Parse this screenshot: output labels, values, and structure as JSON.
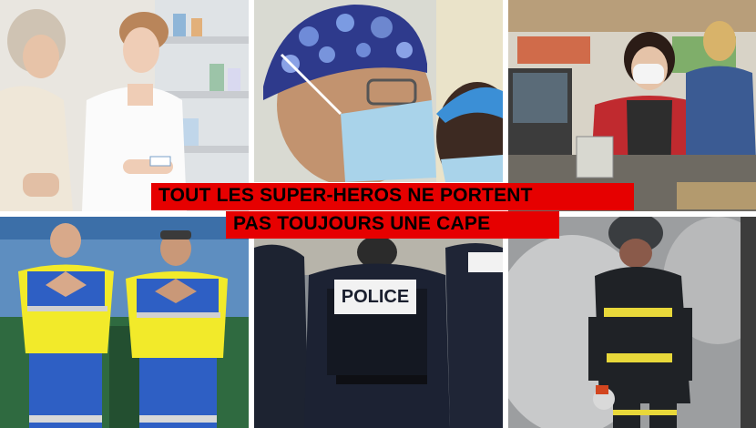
{
  "caption": {
    "line1": "TOUT LES SUPER-HEROS NE PORTENT",
    "line2": "PAS TOUJOURS UNE CAPE"
  },
  "panels": [
    {
      "subject": "pharmacist",
      "description": "Pharmacist advising an elderly customer in a pharmacy"
    },
    {
      "subject": "surgeon",
      "description": "Surgeons in caps and masks"
    },
    {
      "subject": "cashier",
      "description": "Masked supermarket cashier"
    },
    {
      "subject": "garbage-collectors",
      "description": "Two waste collectors making heart signs"
    },
    {
      "subject": "police",
      "description": "Police officers from behind",
      "vest_text": "POLICE"
    },
    {
      "subject": "firefighter",
      "description": "Firefighter with breathing apparatus in smoke"
    }
  ],
  "colors": {
    "banner_red": "#e60000",
    "banner_text": "#000000"
  }
}
